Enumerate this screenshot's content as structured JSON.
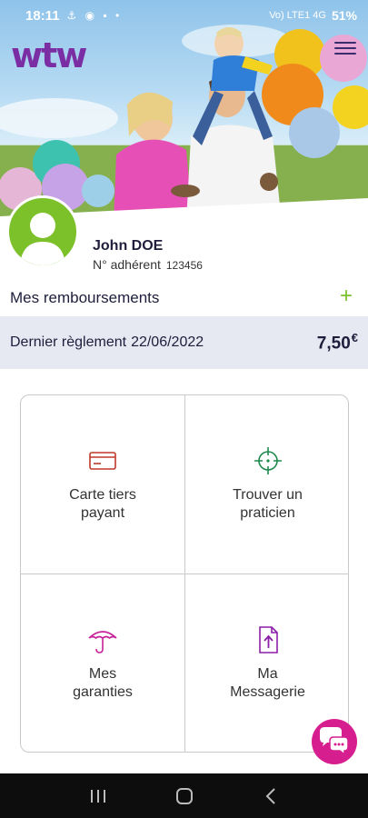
{
  "status_bar": {
    "time": "18:11",
    "notification_icons": "⚓ ◉ ▪ •",
    "network": "Vo) LTE1 4G",
    "battery": "51%"
  },
  "header": {
    "logo": "wtw",
    "brand_color": "#7b2ea3"
  },
  "profile": {
    "name": "John DOE",
    "member_label": "N° adhérent",
    "member_number": "123456"
  },
  "reimbursements": {
    "title": "Mes remboursements",
    "add_symbol": "+",
    "last_payment_label": "Dernier règlement",
    "last_payment_date": "22/06/2022",
    "last_payment_amount": "7,50",
    "currency": "€"
  },
  "tiles": [
    {
      "label_line1": "Carte tiers",
      "label_line2": "payant",
      "icon": "card-icon",
      "color": "#c0392b"
    },
    {
      "label_line1": "Trouver un",
      "label_line2": "praticien",
      "icon": "crosshair-icon",
      "color": "#1f8a4c"
    },
    {
      "label_line1": "Mes",
      "label_line2": "garanties",
      "icon": "umbrella-icon",
      "color": "#c8209a"
    },
    {
      "label_line1": "Ma",
      "label_line2": "Messagerie",
      "icon": "upload-file-icon",
      "color": "#8b1fa8"
    }
  ],
  "accent": {
    "green": "#7cc02a",
    "chat": "#d61e8f"
  }
}
